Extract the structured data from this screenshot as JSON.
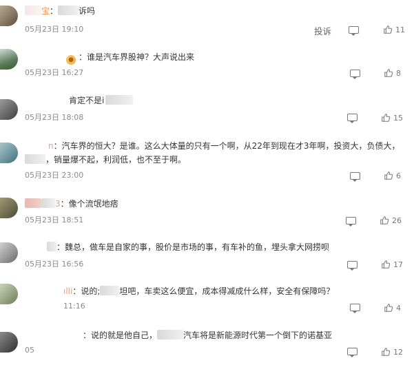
{
  "report_label": "投诉",
  "comments": [
    {
      "prefix": "宝",
      "text": "诉吗",
      "time": "05月23日 19:10",
      "likes": "11",
      "avatar_color": "#7a6b5a"
    },
    {
      "prefix": "",
      "text": "谁是汽车界股神？大声说出来",
      "time": "05月23日 16:27",
      "likes": "8",
      "avatar_color": "#5f7a62"
    },
    {
      "prefix": "",
      "text": "肯定不是i",
      "time": "05月23日 18:08",
      "likes": "15",
      "avatar_color": "#6b6b6b"
    },
    {
      "prefix": "n",
      "text": "汽车界的恒大？是谁。这么大体量的只有一个啊，从22年到现在才3年啊，投资大，负债大，",
      "text2": "销量爆不起，利润低，也不至于啊。",
      "time": "05月23日 23:00",
      "likes": "6",
      "avatar_color": "#4f7f8c"
    },
    {
      "prefix": "3",
      "text": "像个流氓地痞",
      "time": "05月23日 18:51",
      "likes": "26",
      "avatar_color": "#5d5d48"
    },
    {
      "prefix": "",
      "text": "魏总，做车是自家的事，股价是市场的事，有车补的鱼，埋头拿大网捞呗",
      "time": "05月23日 16:56",
      "likes": "17",
      "avatar_color": "#6e6e6e"
    },
    {
      "prefix": "ılli",
      "text": "说的",
      "text_mid": "坦吧，车卖这么便宜，成本得减成什么样，安全有保障吗？",
      "time": "11:16",
      "likes": "4",
      "avatar_color": "#7d8a6a"
    },
    {
      "prefix": "",
      "text": "说的就是他自己，",
      "text_mid": "汽车将是新能源时代第一个倒下的诺基亚",
      "time": "05",
      "likes": "12",
      "avatar_color": "#505050"
    }
  ]
}
